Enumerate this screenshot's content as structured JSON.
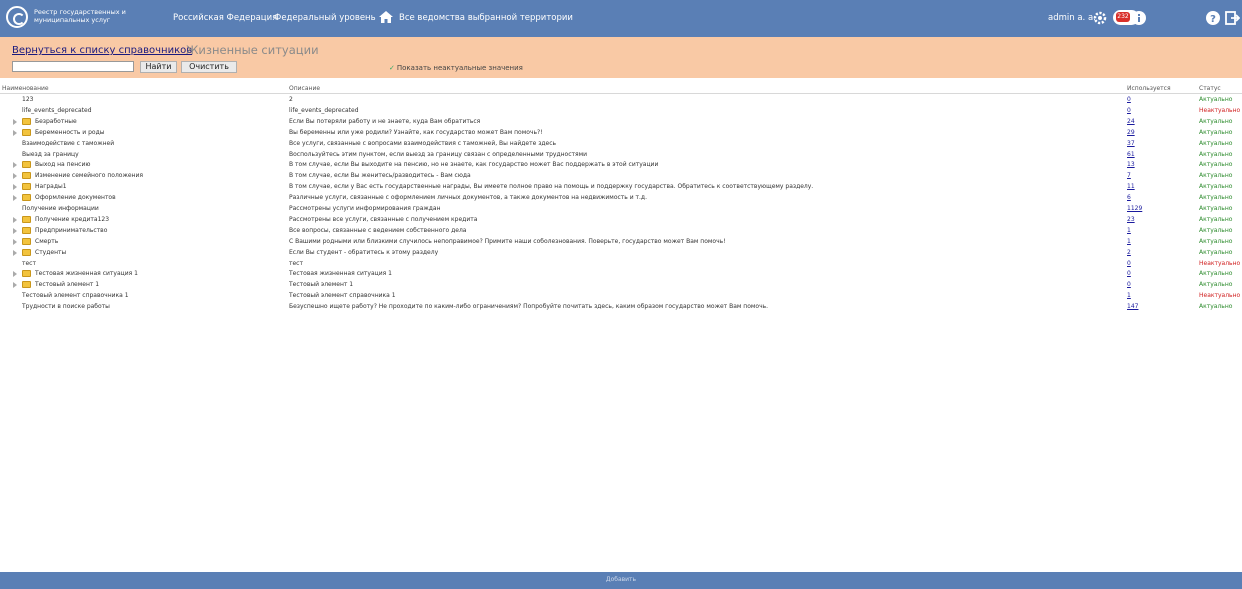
{
  "topbar": {
    "logo_text": "Реестр государственных и муниципальных услуг",
    "nav": [
      "Российская Федерация",
      "Федеральный уровень",
      "Все ведомства выбранной территории"
    ],
    "user": "admin a. a.",
    "badge_count": "232",
    "colors": {
      "bar": "#5a7fb5",
      "badge": "#d9302b"
    }
  },
  "header": {
    "back_link": "Вернуться к списку справочников",
    "title": "Жизненные ситуации",
    "search": {
      "value": "",
      "placeholder": ""
    },
    "find_button": "Найти",
    "clear_button": "Очистить",
    "show_inactive_label": "Показать неактуальные значения",
    "show_inactive_checked": true
  },
  "table": {
    "columns": [
      "Наименование",
      "Описание",
      "Используется",
      "Статус"
    ],
    "rows": [
      {
        "name": "123",
        "folder": false,
        "desc": "2",
        "used": "0",
        "status": "Актуально",
        "active": true
      },
      {
        "name": "life_events_deprecated",
        "folder": false,
        "desc": "life_events_deprecated",
        "used": "0",
        "status": "Неактуально",
        "active": false
      },
      {
        "name": "Безработные",
        "folder": true,
        "desc": "Если Вы потеряли работу и не знаете, куда Вам обратиться",
        "used": "24",
        "status": "Актуально",
        "active": true
      },
      {
        "name": "Беременность и роды",
        "folder": true,
        "desc": "Вы беременны или уже родили? Узнайте, как государство может Вам помочь?!",
        "used": "29",
        "status": "Актуально",
        "active": true
      },
      {
        "name": "Взаимодействие с таможней",
        "folder": false,
        "desc": "Все услуги, связанные с вопросами взаимодействия с таможней, Вы найдете здесь",
        "used": "37",
        "status": "Актуально",
        "active": true
      },
      {
        "name": "Выезд за границу",
        "folder": false,
        "desc": "Воспользуйтесь этим пунктом, если выезд за границу связан с определенными трудностями",
        "used": "61",
        "status": "Актуально",
        "active": true
      },
      {
        "name": "Выход на пенсию",
        "folder": true,
        "desc": "В том случае, если Вы выходите на пенсию, но не знаете, как государство может Вас поддержать в этой ситуации",
        "used": "13",
        "status": "Актуально",
        "active": true
      },
      {
        "name": "Изменение семейного положения",
        "folder": true,
        "desc": "В том случае, если Вы женитесь/разводитесь - Вам сюда",
        "used": "7",
        "status": "Актуально",
        "active": true
      },
      {
        "name": "Награды1",
        "folder": true,
        "desc": "В том случае, если у Вас есть государственные награды, Вы имеете полное право на помощь и поддержку государства. Обратитесь к соответствующему разделу.",
        "used": "11",
        "status": "Актуально",
        "active": true
      },
      {
        "name": "Оформление документов",
        "folder": true,
        "desc": "Различные услуги, связанные с оформлением личных документов, а также документов на недвижимость и т.д.",
        "used": "6",
        "status": "Актуально",
        "active": true
      },
      {
        "name": "Получение информации",
        "folder": false,
        "desc": "Рассмотрены услуги информирования граждан",
        "used": "1129",
        "status": "Актуально",
        "active": true
      },
      {
        "name": "Получение кредита123",
        "folder": true,
        "desc": "Рассмотрены все услуги, связанные с получением кредита",
        "used": "23",
        "status": "Актуально",
        "active": true
      },
      {
        "name": "Предпринимательство",
        "folder": true,
        "desc": "Все вопросы, связанные с ведением собственного дела",
        "used": "1",
        "status": "Актуально",
        "active": true
      },
      {
        "name": "Смерть",
        "folder": true,
        "desc": "С Вашими родными или близкими случилось непоправимое? Примите наши соболезнования. Поверьте, государство может Вам помочь!",
        "used": "1",
        "status": "Актуально",
        "active": true
      },
      {
        "name": "Студенты",
        "folder": true,
        "desc": "Если Вы студент - обратитесь к этому разделу",
        "used": "2",
        "status": "Актуально",
        "active": true
      },
      {
        "name": "тест",
        "folder": false,
        "desc": "тест",
        "used": "0",
        "status": "Неактуально",
        "active": false
      },
      {
        "name": "Тестовая жизненная ситуация 1",
        "folder": true,
        "desc": "Тестовая жизненная ситуация 1",
        "used": "0",
        "status": "Актуально",
        "active": true
      },
      {
        "name": "Тестовый элемент 1",
        "folder": true,
        "desc": "Тестовый элемент 1",
        "used": "0",
        "status": "Актуально",
        "active": true
      },
      {
        "name": "Тестовый элемент справочника 1",
        "folder": false,
        "desc": "Тестовый элемент справочника 1",
        "used": "1",
        "status": "Неактуально",
        "active": false
      },
      {
        "name": "Трудности в поиске работы",
        "folder": false,
        "desc": "Безуспешно ищете работу? Не проходите по каким-либо ограничениям? Попробуйте почитать здесь, каким образом государство может Вам помочь.",
        "used": "147",
        "status": "Актуально",
        "active": true
      }
    ]
  },
  "footer": {
    "add_label": "Добавить"
  }
}
